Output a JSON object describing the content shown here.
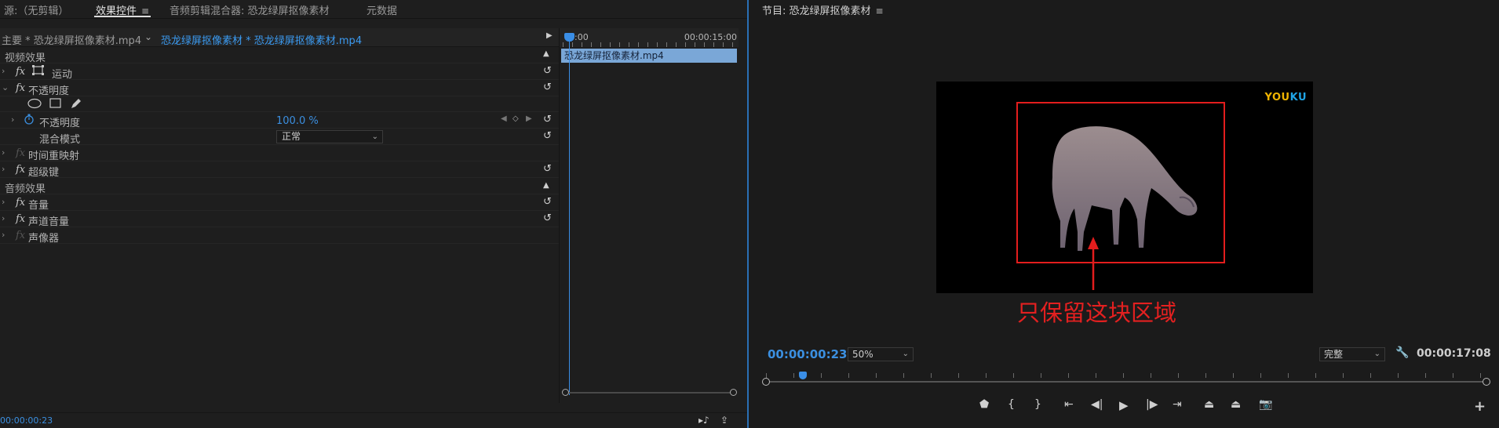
{
  "left": {
    "tabs": [
      {
        "label": "源:（无剪辑）"
      },
      {
        "label": "效果控件"
      },
      {
        "label": "音频剪辑混合器: 恐龙绿屏抠像素材"
      },
      {
        "label": "元数据"
      }
    ],
    "menu_icon": "≡",
    "source_label": "主要 * 恐龙绿屏抠像素材.mp4",
    "clip_label": "恐龙绿屏抠像素材 * 恐龙绿屏抠像素材.mp4",
    "sections": {
      "video": "视频效果",
      "audio": "音频效果"
    },
    "effects": {
      "motion": "运动",
      "opacity": "不透明度",
      "opacity_param": "不透明度",
      "opacity_value": "100.0 %",
      "blend_mode": "混合模式",
      "blend_value": "正常",
      "time_remap": "时间重映射",
      "ultra_key": "超级键",
      "volume": "音量",
      "channel_volume": "声道音量",
      "panner": "声像器"
    },
    "fx_label": "fx",
    "timeline": {
      "start": "0:00",
      "end": "00:00:15:00",
      "clip": "恐龙绿屏抠像素材.mp4"
    },
    "bottom_timecode": "00:00:00:23"
  },
  "right": {
    "title": "节目: 恐龙绿屏抠像素材",
    "menu_icon": "≡",
    "watermark_a": "YOU",
    "watermark_b": "KU",
    "annotation": "只保留这块区域",
    "timecode": "00:00:00:23",
    "zoom": "50%",
    "quality": "完整",
    "duration": "00:00:17:08"
  },
  "colors": {
    "accent_blue": "#3b8fe0",
    "annotation_red": "#e31d1d",
    "clip_bar": "#7aa7d7"
  }
}
